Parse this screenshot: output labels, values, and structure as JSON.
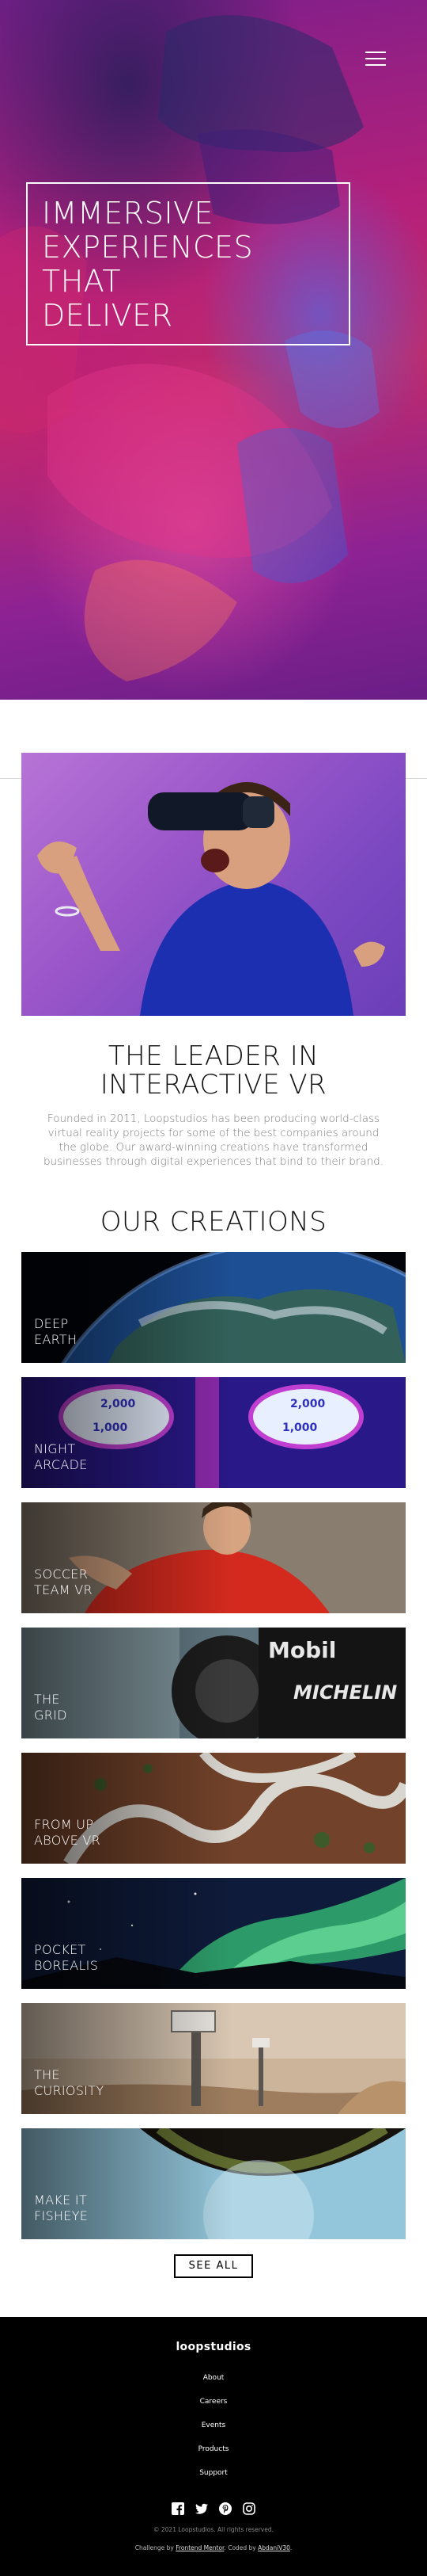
{
  "hero": {
    "title_lines": [
      "Immersive",
      "experiences",
      "that",
      "deliver"
    ]
  },
  "about": {
    "title_lines": [
      "The leader in",
      "interactive VR"
    ],
    "text": "Founded in 2011, Loopstudios has been producing world-class virtual reality projects for some of the best companies around the globe. Our award-winning creations have transformed businesses through digital experiences that bind to their brand."
  },
  "creations": {
    "title": "Our creations",
    "items": [
      {
        "line1": "Deep",
        "line2": "earth"
      },
      {
        "line1": "Night",
        "line2": "arcade"
      },
      {
        "line1": "Soccer",
        "line2": "team VR"
      },
      {
        "line1": "The",
        "line2": "grid"
      },
      {
        "line1": "From up",
        "line2": "above VR"
      },
      {
        "line1": "Pocket",
        "line2": "borealis"
      },
      {
        "line1": "The",
        "line2": "curiosity"
      },
      {
        "line1": "Make it",
        "line2": "fisheye"
      }
    ],
    "see_all": "See all"
  },
  "footer": {
    "logo": "loopstudios",
    "nav": [
      "About",
      "Careers",
      "Events",
      "Products",
      "Support"
    ],
    "social_icons": [
      "facebook-icon",
      "twitter-icon",
      "pinterest-icon",
      "instagram-icon"
    ],
    "copyright": "© 2021 Loopstudios. All rights reserved.",
    "credit_prefix": "Challenge by",
    "credit_link1": "Frontend Mentor",
    "credit_mid": ". Coded by",
    "credit_link2": "AbdaniV30",
    "credit_suffix": "."
  }
}
